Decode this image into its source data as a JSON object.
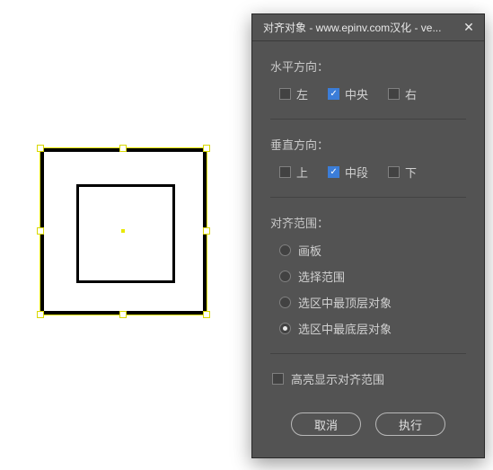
{
  "dialog": {
    "title": "对齐对象 - www.epinv.com汉化 - ve...",
    "horizontal": {
      "label": "水平方向：",
      "left": "左",
      "center": "中央",
      "right": "右",
      "checked": "center"
    },
    "vertical": {
      "label": "垂直方向：",
      "top": "上",
      "middle": "中段",
      "bottom": "下",
      "checked": "middle"
    },
    "scope": {
      "label": "对齐范围：",
      "options": {
        "artboard": "画板",
        "selection": "选择范围",
        "topmost": "选区中最顶层对象",
        "bottommost": "选区中最底层对象"
      },
      "selected": "bottommost"
    },
    "highlight": "高亮显示对齐范围",
    "buttons": {
      "cancel": "取消",
      "execute": "执行"
    }
  }
}
